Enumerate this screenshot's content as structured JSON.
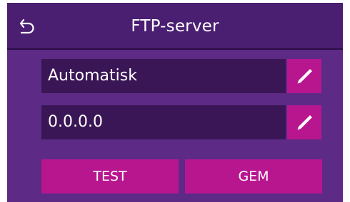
{
  "header": {
    "title": "FTP-server",
    "back_icon": "back-arrow-icon"
  },
  "fields": [
    {
      "value": "Automatisk",
      "edit_icon": "pencil-icon"
    },
    {
      "value": "0.0.0.0",
      "edit_icon": "pencil-icon"
    }
  ],
  "buttons": {
    "test_label": "TEST",
    "save_label": "GEM"
  },
  "colors": {
    "background": "#5d2a86",
    "header": "#4a1f72",
    "field": "#3a1656",
    "accent": "#b8168f",
    "text": "#ffffff"
  }
}
